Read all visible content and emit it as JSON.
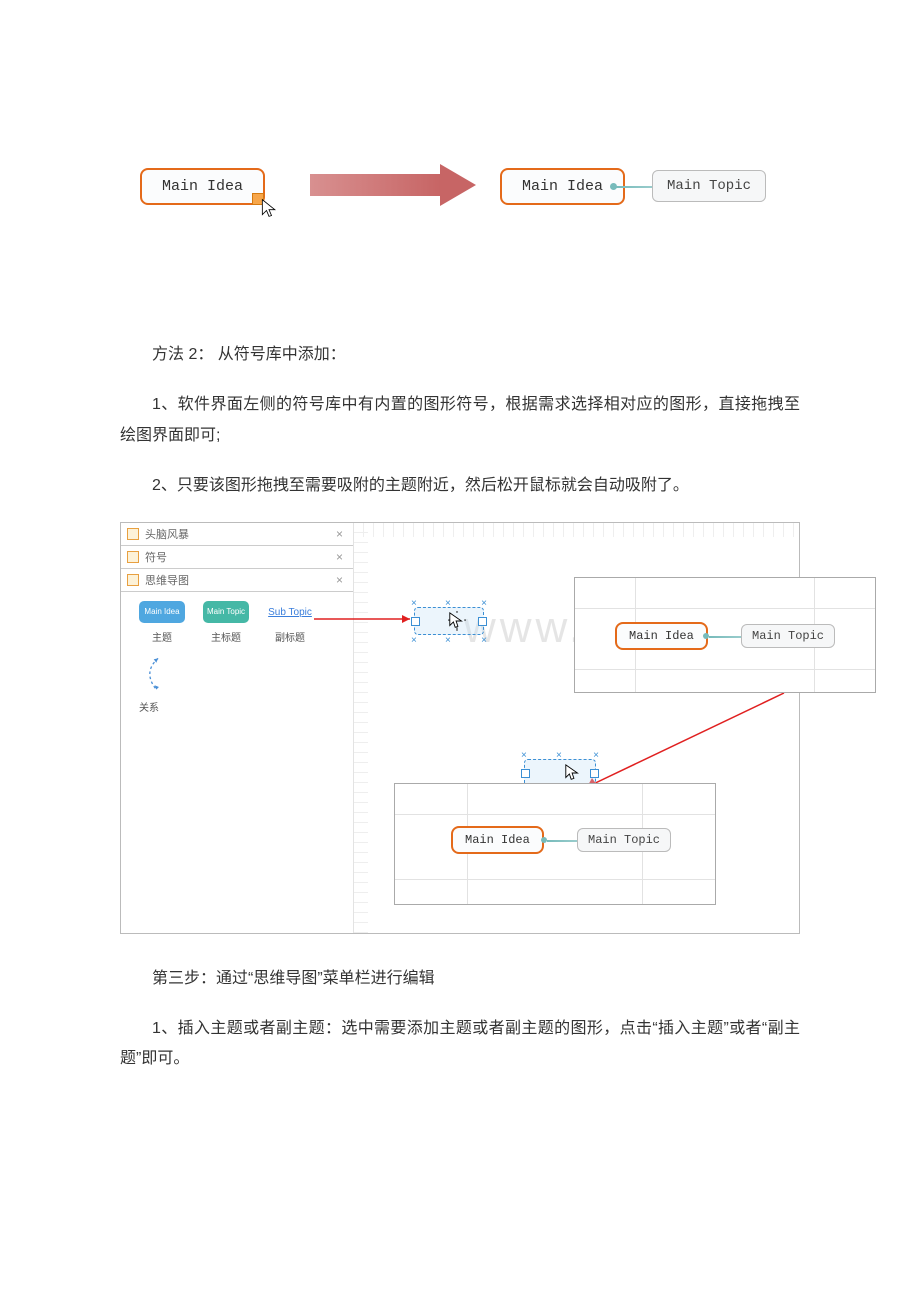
{
  "topDiagram": {
    "leftNode": "Main Idea",
    "rightNode": "Main Idea",
    "topicNode": "Main Topic"
  },
  "text": {
    "method2": "方法 2： 从符号库中添加：",
    "p1": "1、软件界面左侧的符号库中有内置的图形符号，根据需求选择相对应的图形，直接拖拽至绘图界面即可;",
    "p2": "2、只要该图形拖拽至需要吸附的主题附近，然后松开鼠标就会自动吸附了。",
    "step3": "第三步：通过“思维导图”菜单栏进行编辑",
    "p3": "1、插入主题或者副主题：选中需要添加主题或者副主题的图形，点击“插入主题”或者“副主题”即可。"
  },
  "panels": {
    "rows": [
      "头脑风暴",
      "符号",
      "思维导图"
    ],
    "shapeMainIdea": "Main Idea",
    "shapeMainTopic": "Main Topic",
    "subTopic": "Sub Topic",
    "labels": {
      "theme": "主题",
      "mainTitle": "主标题",
      "subTitle": "副标题",
      "relation": "关系"
    }
  },
  "inset": {
    "mainIdea": "Main Idea",
    "mainTopic": "Main Topic"
  },
  "watermark": "www.bdocx.com"
}
